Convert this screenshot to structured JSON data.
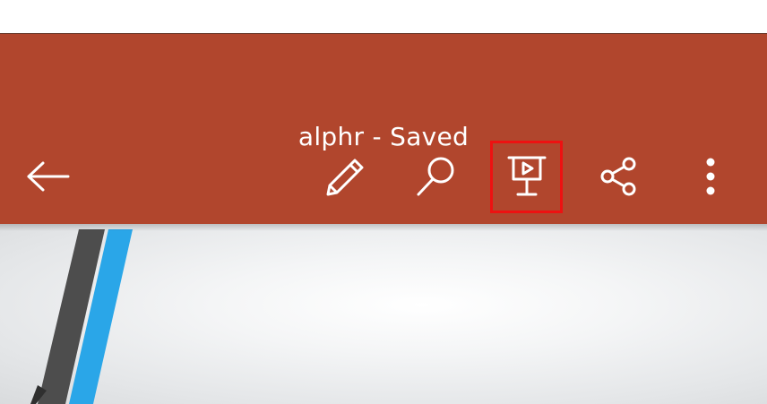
{
  "app_bar": {
    "title": "alphr - Saved",
    "background_color": "#b1462d"
  },
  "toolbar": {
    "icons": [
      {
        "name": "back-arrow-icon"
      },
      {
        "name": "edit-pencil-icon"
      },
      {
        "name": "search-icon"
      },
      {
        "name": "present-slideshow-icon",
        "highlighted": true
      },
      {
        "name": "share-icon"
      },
      {
        "name": "more-options-icon"
      }
    ]
  },
  "highlight_color": "#ee1111",
  "slide": {
    "accent_colors": [
      "#2aa6e8",
      "#4d4d4d"
    ]
  }
}
